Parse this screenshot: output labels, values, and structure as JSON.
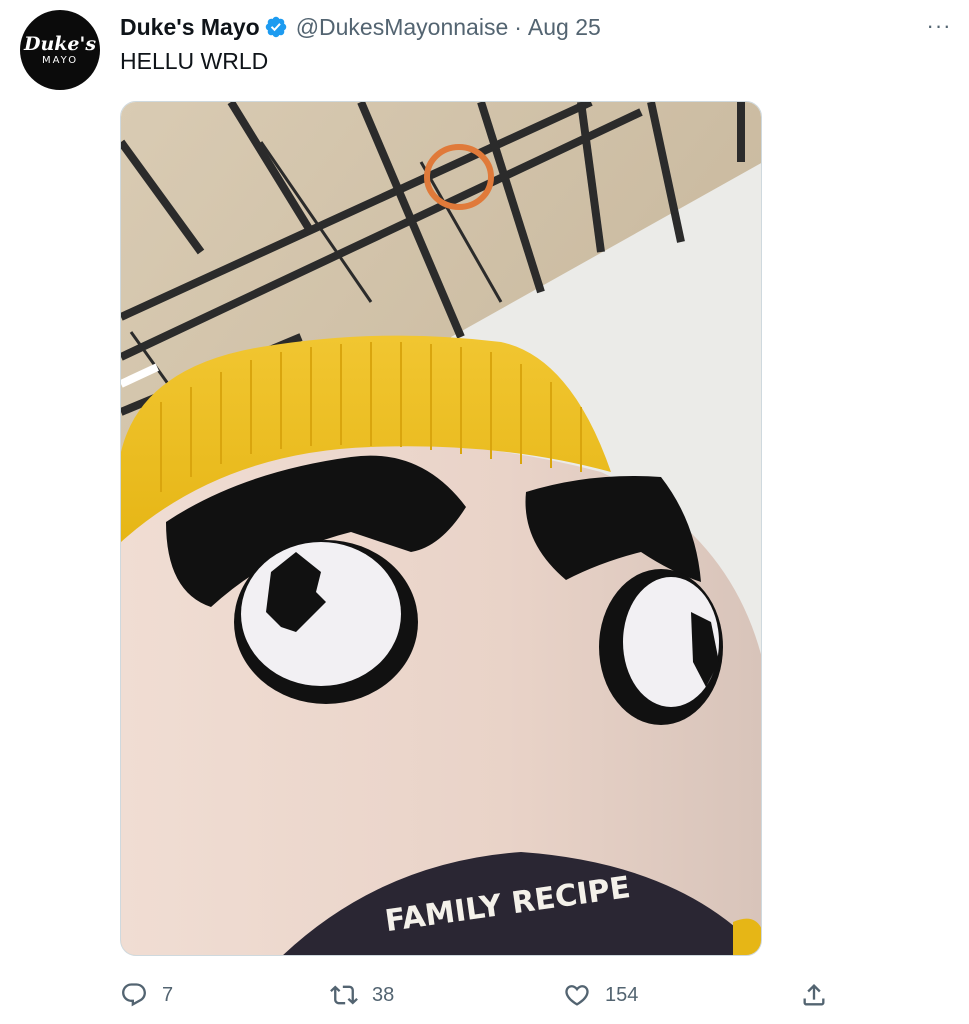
{
  "author": {
    "avatar_text": "Duke's",
    "avatar_subtext": "MAYO",
    "display_name": "Duke's Mayo",
    "handle": "@DukesMayonnaise",
    "separator": "·",
    "date": "Aug 25",
    "verified_icon": "verified-badge-icon"
  },
  "more_label": "···",
  "tweet": {
    "text": "HELLU WRLD"
  },
  "media": {
    "description_icon": "photo",
    "visible_text": "FAMILY RECIPE"
  },
  "actions": {
    "reply": {
      "icon": "reply-icon",
      "count": "7"
    },
    "retweet": {
      "icon": "retweet-icon",
      "count": "38"
    },
    "like": {
      "icon": "heart-icon",
      "count": "154"
    },
    "share": {
      "icon": "share-icon"
    }
  },
  "colors": {
    "text_primary": "#0f1419",
    "text_secondary": "#536471",
    "verified_blue": "#1d9bf0",
    "border": "#cfd9de"
  }
}
